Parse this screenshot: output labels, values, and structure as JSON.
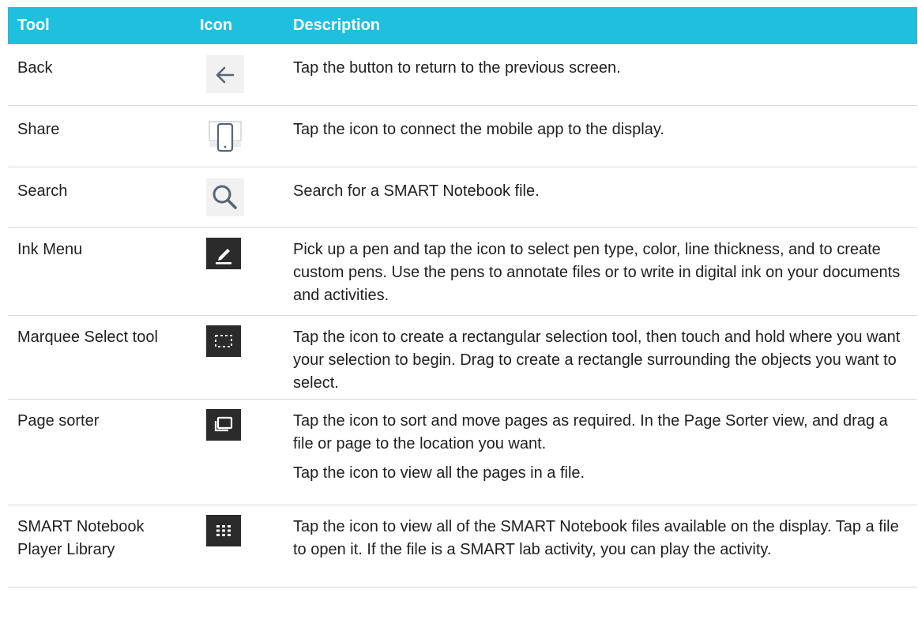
{
  "table": {
    "headers": {
      "tool": "Tool",
      "icon": "Icon",
      "description": "Description"
    },
    "rows": [
      {
        "tool": "Back",
        "icon": "back-arrow-icon",
        "description": [
          "Tap the button to return to the previous screen."
        ]
      },
      {
        "tool": "Share",
        "icon": "share-to-display-icon",
        "description": [
          "Tap the icon to connect the mobile app to the display."
        ]
      },
      {
        "tool": "Search",
        "icon": "search-icon",
        "description": [
          "Search for a SMART Notebook file."
        ]
      },
      {
        "tool": "Ink Menu",
        "icon": "pen-icon",
        "description": [
          "Pick up a pen and tap the icon to select pen type, color, line thickness, and to create custom pens. Use the pens to annotate files or to write in digital ink on your documents and activities."
        ]
      },
      {
        "tool": "Marquee Select tool",
        "icon": "marquee-select-icon",
        "description": [
          "Tap the icon to create a rectangular selection tool, then touch and hold where you want your selection to begin. Drag to create a rectangle surrounding the objects you want to select."
        ]
      },
      {
        "tool": "Page sorter",
        "icon": "page-sorter-icon",
        "description": [
          "Tap the icon to sort and move pages as required. In the Page Sorter view, and drag a file or page to the location you want.",
          "Tap the icon to view all the pages in a file."
        ]
      },
      {
        "tool": "SMART Notebook Player Library",
        "icon": "library-grid-icon",
        "description": [
          "Tap the icon to view all of the SMART Notebook files available on the display. Tap a file to open it. If the file is a SMART lab activity, you can play the activity."
        ]
      }
    ]
  },
  "colors": {
    "header_bg": "#1fc0de",
    "header_text": "#ffffff",
    "icon_dark_bg": "#2b2b2b",
    "icon_light_bg": "#f1f1f1"
  }
}
